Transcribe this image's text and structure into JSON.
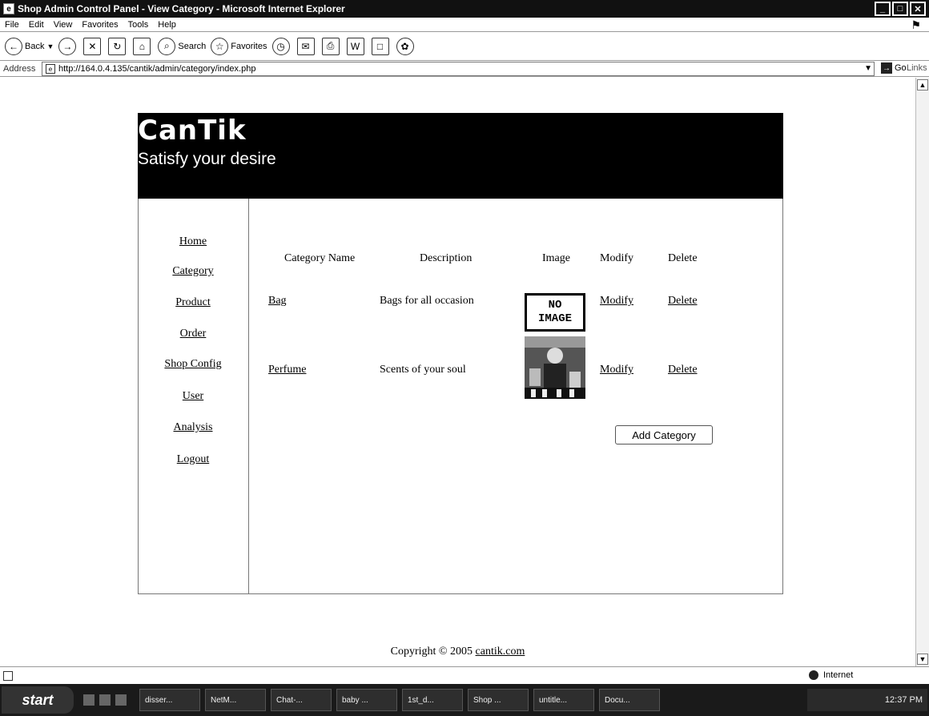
{
  "window": {
    "title": "Shop Admin Control Panel - View Category - Microsoft Internet Explorer"
  },
  "menu": [
    "File",
    "Edit",
    "View",
    "Favorites",
    "Tools",
    "Help"
  ],
  "toolbar": {
    "back": "Back",
    "search": "Search",
    "favorites": "Favorites"
  },
  "address": {
    "label": "Address",
    "url": "http://164.0.4.135/cantik/admin/category/index.php",
    "go": "Go",
    "links": "Links"
  },
  "site": {
    "logo": "CanTik",
    "tagline": "Satisfy your desire"
  },
  "nav": [
    "Home",
    "Category",
    "Product",
    "Order",
    "Shop Config",
    "User",
    "Analysis",
    "Logout"
  ],
  "table": {
    "headers": [
      "Category Name",
      "Description",
      "Image",
      "Modify",
      "Delete"
    ],
    "rows": [
      {
        "name": "Bag",
        "description": "Bags for all occasion",
        "image_text": [
          "NO",
          "IMAGE"
        ],
        "modify": "Modify",
        "delete": "Delete"
      },
      {
        "name": "Perfume",
        "description": "Scents of your soul",
        "modify": "Modify",
        "delete": "Delete"
      }
    ]
  },
  "add_button": "Add Category",
  "footer": {
    "copyright": "Copyright © 2005",
    "link": "cantik.com"
  },
  "status": {
    "zone": "Internet"
  },
  "taskbar": {
    "start": "start",
    "tasks": [
      "disser...",
      "NetM...",
      "Chat-...",
      "baby ...",
      "1st_d...",
      "Shop ...",
      "untitle...",
      "Docu..."
    ],
    "clock": "12:37 PM"
  }
}
